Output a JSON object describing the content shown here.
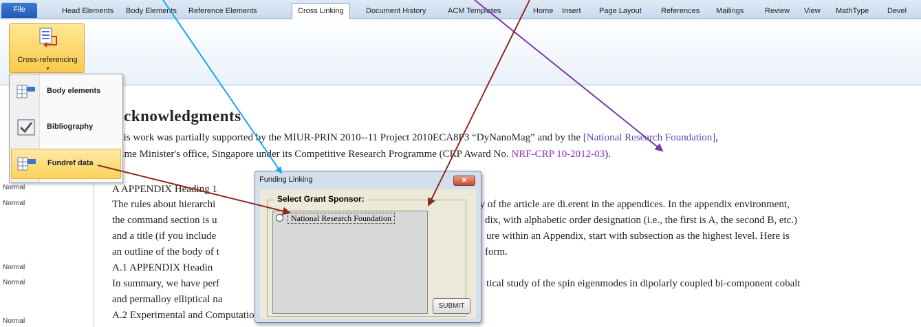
{
  "ribbon": {
    "file_tab": "File",
    "tabs": [
      "Head Elements",
      "Body Elements",
      "Reference Elements",
      "Cross Linking",
      "Document History",
      "ACM Templates",
      "Home",
      "Insert",
      "Page Layout",
      "References",
      "Mailings",
      "Review",
      "View",
      "MathType",
      "Devel"
    ],
    "active_tab": "Cross Linking",
    "cross_ref_button": "Cross-referencing"
  },
  "menu": {
    "items": [
      "Body elements",
      "Bibliography",
      "Fundref data"
    ],
    "highlighted": "Fundref data"
  },
  "style_column": {
    "labels": [
      "Normal",
      "Normal",
      "Normal",
      "Normal",
      "Normal"
    ]
  },
  "document": {
    "heading": "Acknowledgments",
    "ack_line1_a": "This work was partially supported by the MIUR-PRIN 2010--11 Project 2010ECA8P3 “DyNanoMag” and by the ",
    "ack_line1_link": "[National Research Foundation]",
    "ack_line1_b": ",",
    "ack_line2_a": "Prime Minister's office, Singapore under its Competitive Research Programme (CRP Award No. ",
    "ack_line2_link": "NRF-CRP 10-2012-03",
    "ack_line2_b": ").",
    "appendix_heading": "A   APPENDIX Heading 1",
    "p1_l1_a": "The rules about hierarchi",
    "p1_l1_b": "dy of the article are di.erent in the appendices. In the appendix environment,",
    "p1_l2_a": "the command section is u",
    "p1_l2_b": "dix, with alphabetic order designation (i.e., the first is A, the second B, etc.)",
    "p1_l3_a": "and a title (if you include",
    "p1_l3_b": "ure within an Appendix, start with subsection as the highest level. Here is",
    "p1_l4_a": "an outline of the body of t",
    "p1_l4_b": "form.",
    "sub_heading": "A.1     APPENDIX Headin",
    "p2_l1_a": "In summary, we have perf",
    "p2_l1_b": "tical study of the spin eigenmodes in dipolarly coupled bi-component cobalt",
    "p2_l2_a": "and permalloy elliptical na",
    "p2_l3": "A.2  Experimental and Computational Details (APPENDIX Heading 2)"
  },
  "dialog": {
    "title": "Funding Linking",
    "group_label": "Select Grant Sponsor:",
    "options": [
      "National Research Foundation"
    ],
    "submit": "SUBMIT",
    "close_icon": "close-icon"
  },
  "colors": {
    "arrow_blue": "#1aa7e6",
    "arrow_purple": "#7a3aa0",
    "arrow_darkred": "#8e2a1f",
    "link_purple": "#8b2fc9"
  }
}
